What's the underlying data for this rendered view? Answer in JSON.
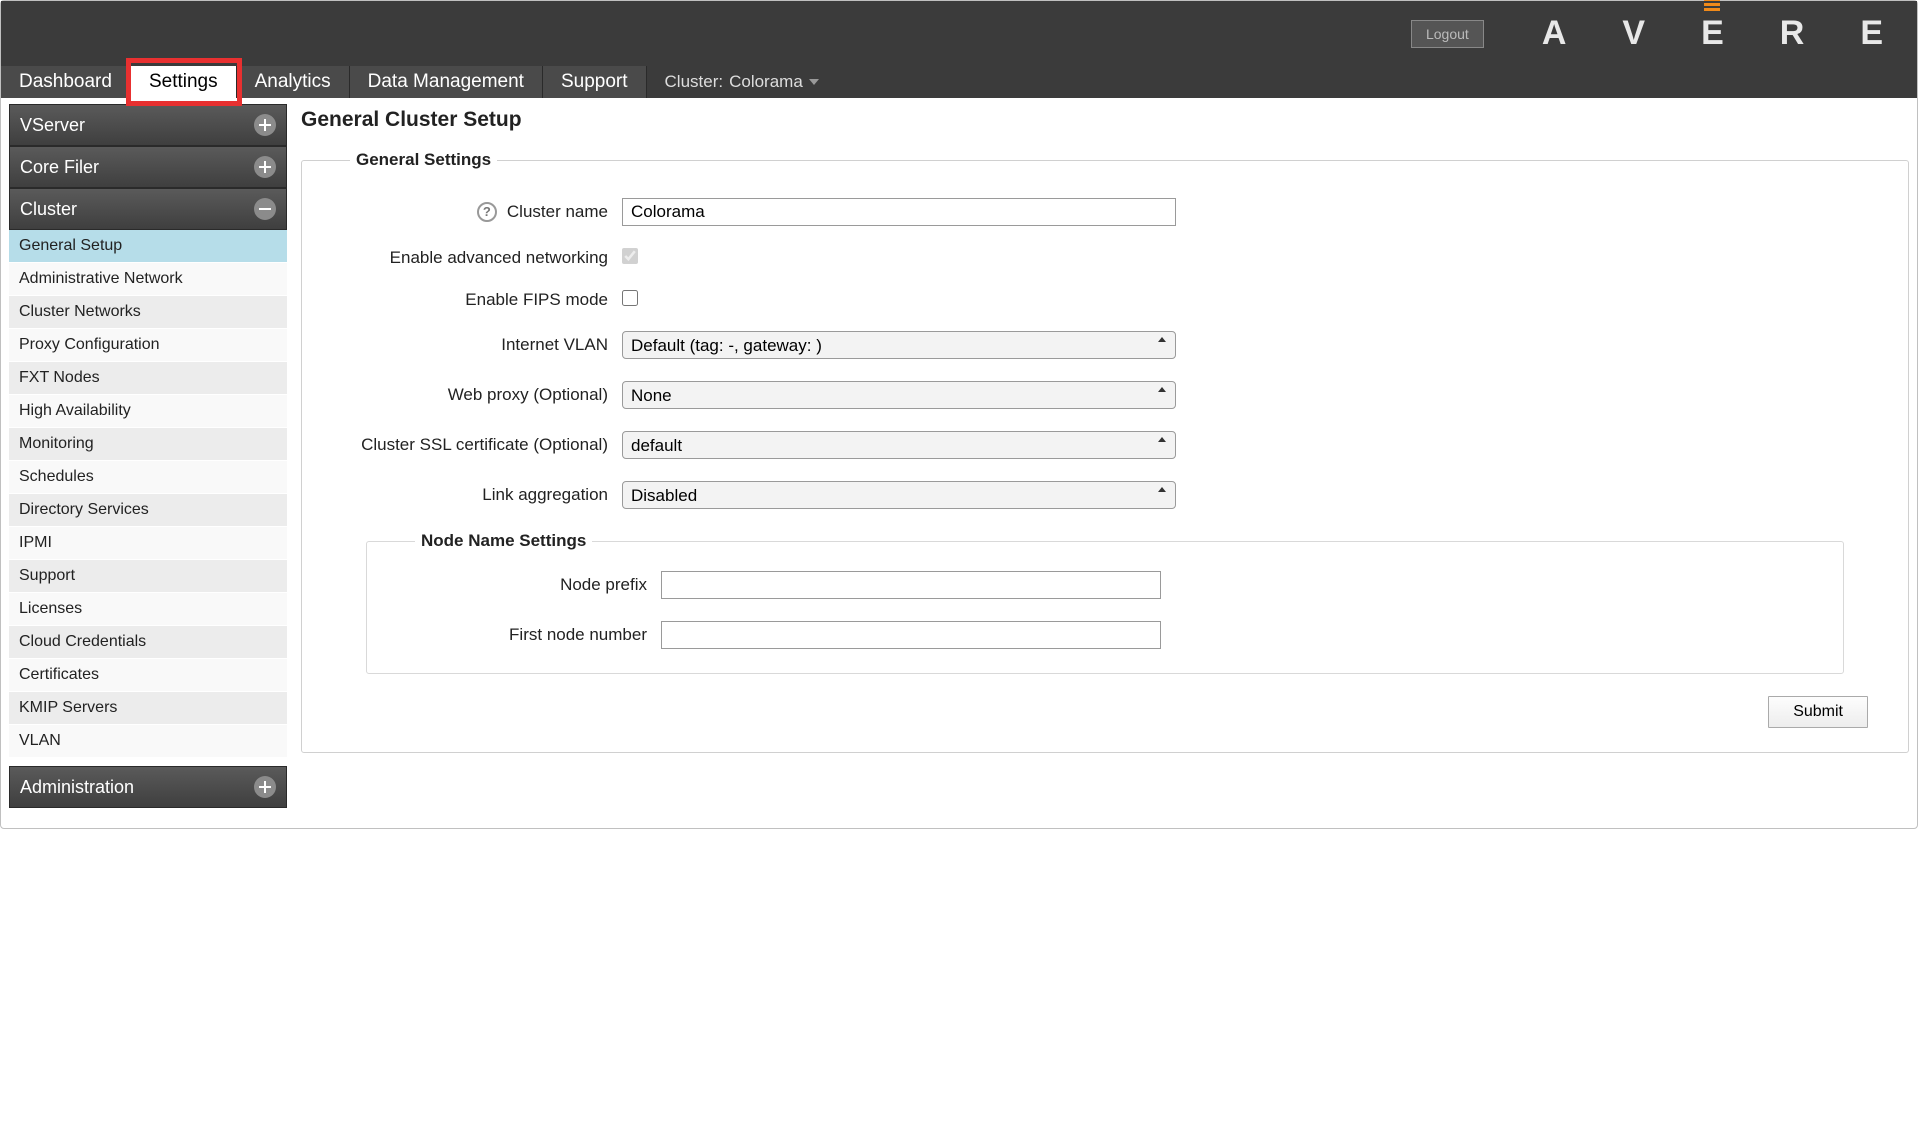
{
  "header": {
    "logout": "Logout",
    "cluster_prefix": "Cluster:",
    "cluster_name": "Colorama",
    "logo_text": "AVERE"
  },
  "tabs": {
    "dashboard": "Dashboard",
    "settings": "Settings",
    "analytics": "Analytics",
    "data_mgmt": "Data Management",
    "support": "Support"
  },
  "sidebar": {
    "groups": {
      "vserver": {
        "title": "VServer"
      },
      "corefiler": {
        "title": "Core Filer"
      },
      "cluster": {
        "title": "Cluster"
      },
      "administration": {
        "title": "Administration"
      }
    },
    "cluster_items": [
      "General Setup",
      "Administrative Network",
      "Cluster Networks",
      "Proxy Configuration",
      "FXT Nodes",
      "High Availability",
      "Monitoring",
      "Schedules",
      "Directory Services",
      "IPMI",
      "Support",
      "Licenses",
      "Cloud Credentials",
      "Certificates",
      "KMIP Servers",
      "VLAN"
    ]
  },
  "main": {
    "title": "General Cluster Setup",
    "legend_general": "General Settings",
    "legend_node": "Node Name Settings",
    "labels": {
      "cluster_name": "Cluster name",
      "adv_net": "Enable advanced networking",
      "fips": "Enable FIPS mode",
      "vlan": "Internet VLAN",
      "web_proxy": "Web proxy (Optional)",
      "ssl_cert": "Cluster SSL certificate (Optional)",
      "link_agg": "Link aggregation",
      "node_prefix": "Node prefix",
      "first_node": "First node number"
    },
    "values": {
      "cluster_name": "Colorama",
      "adv_net_checked": true,
      "fips_checked": false,
      "vlan": "Default (tag: -, gateway:              )",
      "web_proxy": "None",
      "ssl_cert": "default",
      "link_agg": "Disabled",
      "node_prefix": "",
      "first_node": ""
    },
    "submit": "Submit",
    "help_glyph": "?"
  }
}
